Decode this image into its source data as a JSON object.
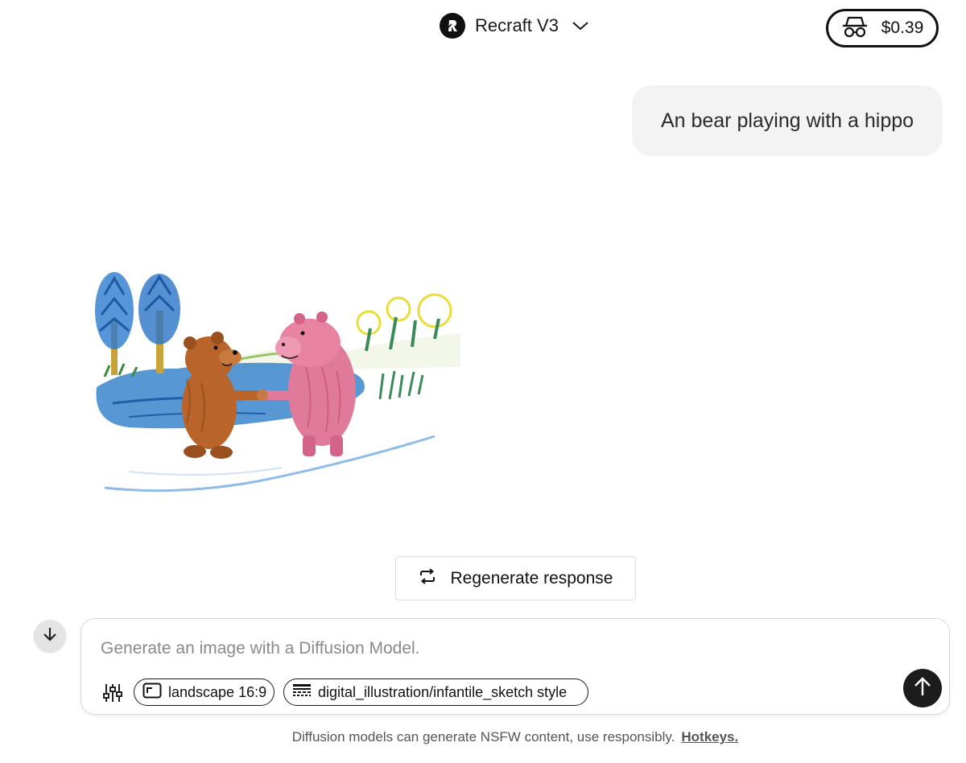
{
  "header": {
    "model_name": "Recraft V3",
    "model_icon": "recraft-logo-icon",
    "dropdown_icon": "chevron-down-icon",
    "incognito_icon": "incognito-icon",
    "credit_balance": "$0.39"
  },
  "conversation": {
    "user_prompt": "An bear playing with a hippo",
    "generated_image_alt": "bear-and-hippo-crayon-sketch",
    "regenerate_label": "Regenerate response",
    "regenerate_icon": "repeat-icon"
  },
  "composer": {
    "placeholder": "Generate an image with a Diffusion Model.",
    "value": "",
    "settings_icon": "sliders-icon",
    "aspect_chip": {
      "icon": "aspect-ratio-icon",
      "label": "landscape 16:9"
    },
    "style_chip": {
      "icon": "style-icon",
      "label": "digital_illustration/infantile_sketch style"
    },
    "send_icon": "arrow-up-icon",
    "scroll_icon": "arrow-down-icon"
  },
  "footer": {
    "disclaimer": "Diffusion models can generate NSFW content, use responsibly.",
    "hotkeys_link": "Hotkeys."
  },
  "colors": {
    "bubble_bg": "#f3f3f3",
    "send_bg": "#1c1c1c",
    "scroll_bg": "#e4e4e4",
    "bear": "#b8642a",
    "hippo": "#e07a9a",
    "water": "#2f7fc9"
  }
}
